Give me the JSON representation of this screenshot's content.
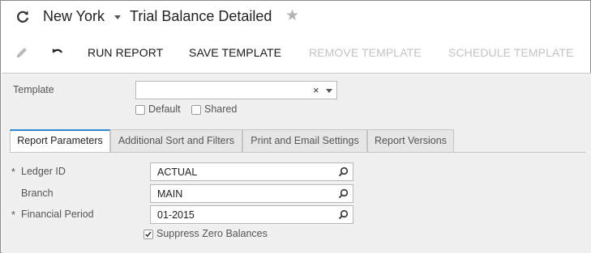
{
  "header": {
    "refresh_icon": "refresh-icon",
    "company": "New York",
    "title": "Trial Balance Detailed",
    "favorite_icon": "star-icon"
  },
  "toolbar": {
    "edit_icon": "pencil-icon",
    "undo_icon": "undo-icon",
    "run_report": "RUN REPORT",
    "save_template": "SAVE TEMPLATE",
    "remove_template": "REMOVE TEMPLATE",
    "schedule_template": "SCHEDULE TEMPLATE"
  },
  "template_section": {
    "label": "Template",
    "value": "",
    "clear_glyph": "×",
    "default_label": "Default",
    "shared_label": "Shared",
    "default_checked": false,
    "shared_checked": false
  },
  "tabs": [
    {
      "label": "Report Parameters",
      "active": true
    },
    {
      "label": "Additional Sort and Filters",
      "active": false
    },
    {
      "label": "Print and Email Settings",
      "active": false
    },
    {
      "label": "Report Versions",
      "active": false
    }
  ],
  "parameters": {
    "ledger": {
      "required_mark": "*",
      "label": "Ledger ID",
      "value": "ACTUAL"
    },
    "branch": {
      "label": "Branch",
      "value": "MAIN"
    },
    "period": {
      "required_mark": "*",
      "label": "Financial Period",
      "value": "01-2015"
    },
    "suppress_zero": {
      "label": "Suppress Zero Balances",
      "checked": true
    }
  },
  "colors": {
    "accent": "#2a86cf",
    "panel_bg": "#f0f0f0",
    "disabled_text": "#c3c3c3"
  }
}
